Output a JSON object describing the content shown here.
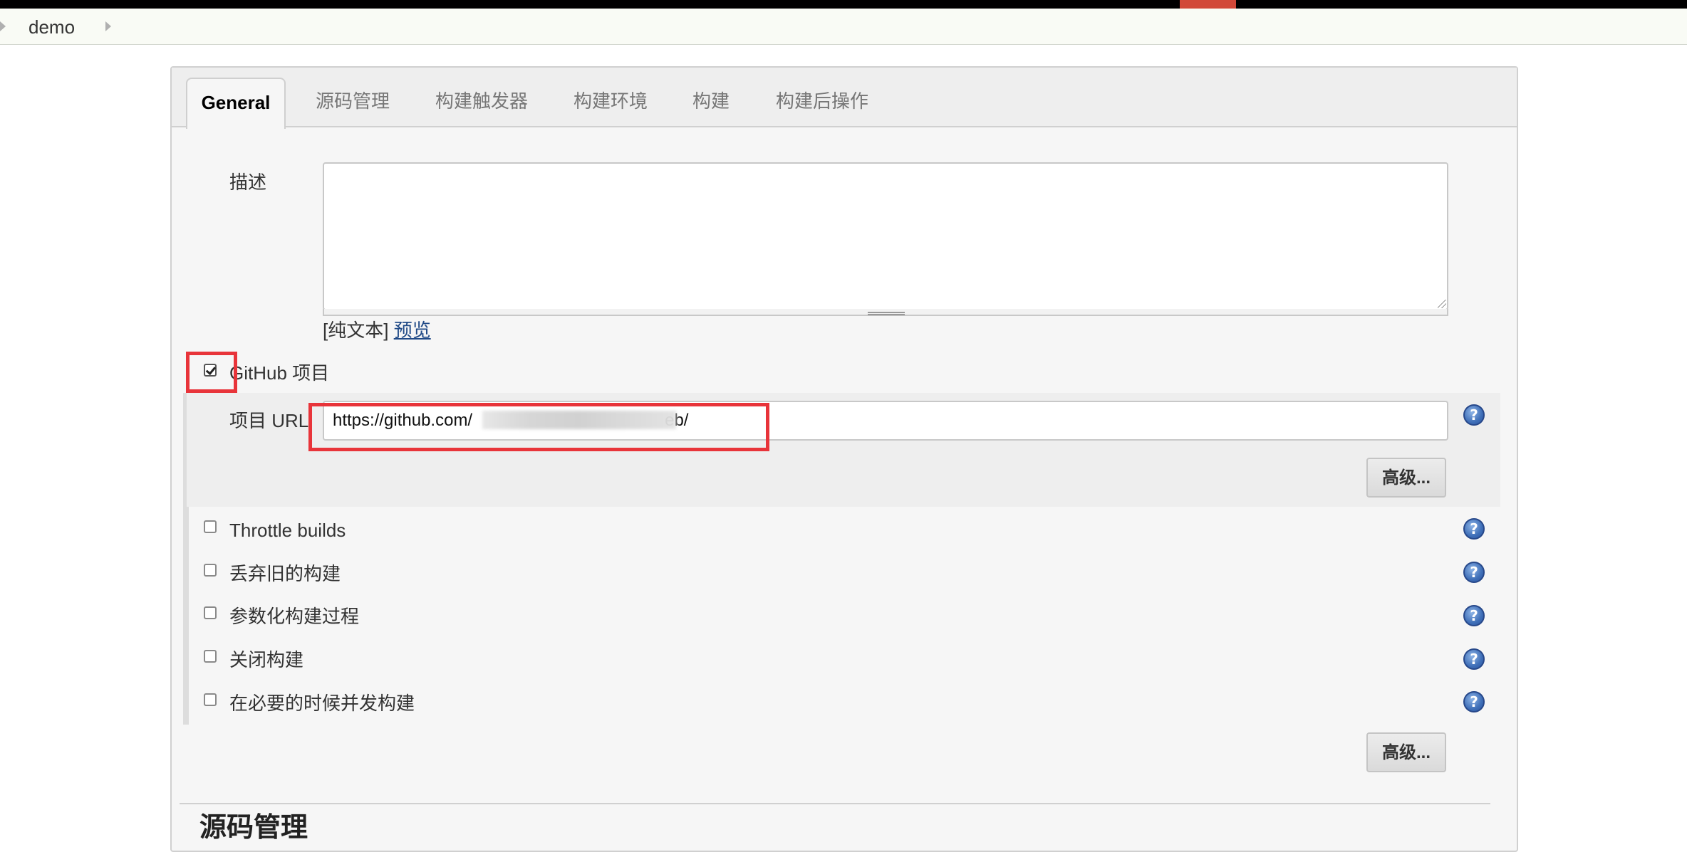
{
  "breadcrumb": {
    "items": [
      "demo"
    ]
  },
  "tabs": [
    {
      "label": "General",
      "active": true
    },
    {
      "label": "源码管理"
    },
    {
      "label": "构建触发器"
    },
    {
      "label": "构建环境"
    },
    {
      "label": "构建"
    },
    {
      "label": "构建后操作"
    }
  ],
  "general": {
    "description_label": "描述",
    "description_value": "",
    "plain_text_label": "[纯文本]",
    "preview_link": "预览",
    "github_project": {
      "label": "GitHub 项目",
      "checked": true
    },
    "project_url_label": "项目 URL",
    "project_url_value": "https://github.com/",
    "project_url_visible_suffix": "eb/",
    "advanced_button": "高级...",
    "options": [
      {
        "label": "Throttle builds",
        "checked": false
      },
      {
        "label": "丢弃旧的构建",
        "checked": false
      },
      {
        "label": "参数化构建过程",
        "checked": false
      },
      {
        "label": "关闭构建",
        "checked": false
      },
      {
        "label": "在必要的时候并发构建",
        "checked": false
      }
    ],
    "advanced_button_2": "高级..."
  },
  "next_section_title": "源码管理",
  "help_glyph": "?",
  "colors": {
    "highlight_red": "#e8343a",
    "topbar_accent": "#d24939",
    "help_icon_blue": "#3f6fb8",
    "link": "#204a87"
  }
}
